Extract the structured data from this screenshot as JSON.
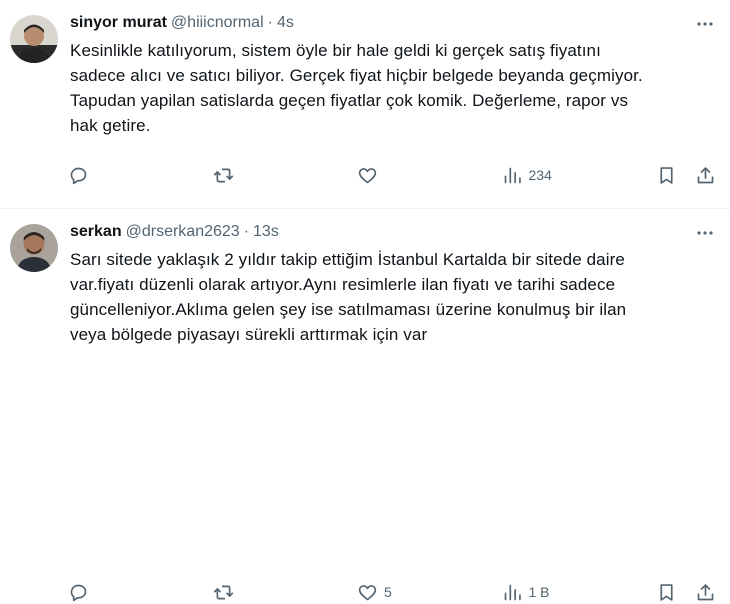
{
  "tweets": [
    {
      "name": "sinyor murat",
      "handle": "@hiiicnormal",
      "time": "4s",
      "text": "Kesinlikle katılıyorum, sistem öyle bir hale geldi ki gerçek satış fiyatını\nsadece alıcı ve satıcı biliyor. Gerçek fiyat hiçbir belgede beyanda geçmiyor.\nTapudan yapilan satislarda geçen fiyatlar çok komik. Değerleme, rapor vs\nhak getire.",
      "likes": "",
      "views": "234",
      "avatar_color": "#3c3a38"
    },
    {
      "name": "serkan",
      "handle": "@drserkan2623",
      "time": "13s",
      "text": "Sarı sitede yaklaşık 2 yıldır takip ettiğim İstanbul Kartalda bir sitede daire\nvar.fiyatı düzenli olarak artıyor.Aynı resimlerle ilan fiyatı ve tarihi sadece\ngüncelleniyor.Aklıma gelen şey ise satılmaması üzerine konulmuş bir ilan\nveya bölgede piyasayı sürekli arttırmak için var",
      "likes": "5",
      "views": "1 B",
      "avatar_color": "#5a4a3e"
    }
  ],
  "icons": {
    "reply": "reply-icon",
    "retweet": "retweet-icon",
    "like": "heart-icon",
    "views": "views-chart-icon",
    "bookmark": "bookmark-icon",
    "share": "share-icon",
    "more": "more-icon"
  },
  "colors": {
    "text": "#0f1419",
    "secondary": "#536471",
    "divider": "#eff3f4"
  }
}
